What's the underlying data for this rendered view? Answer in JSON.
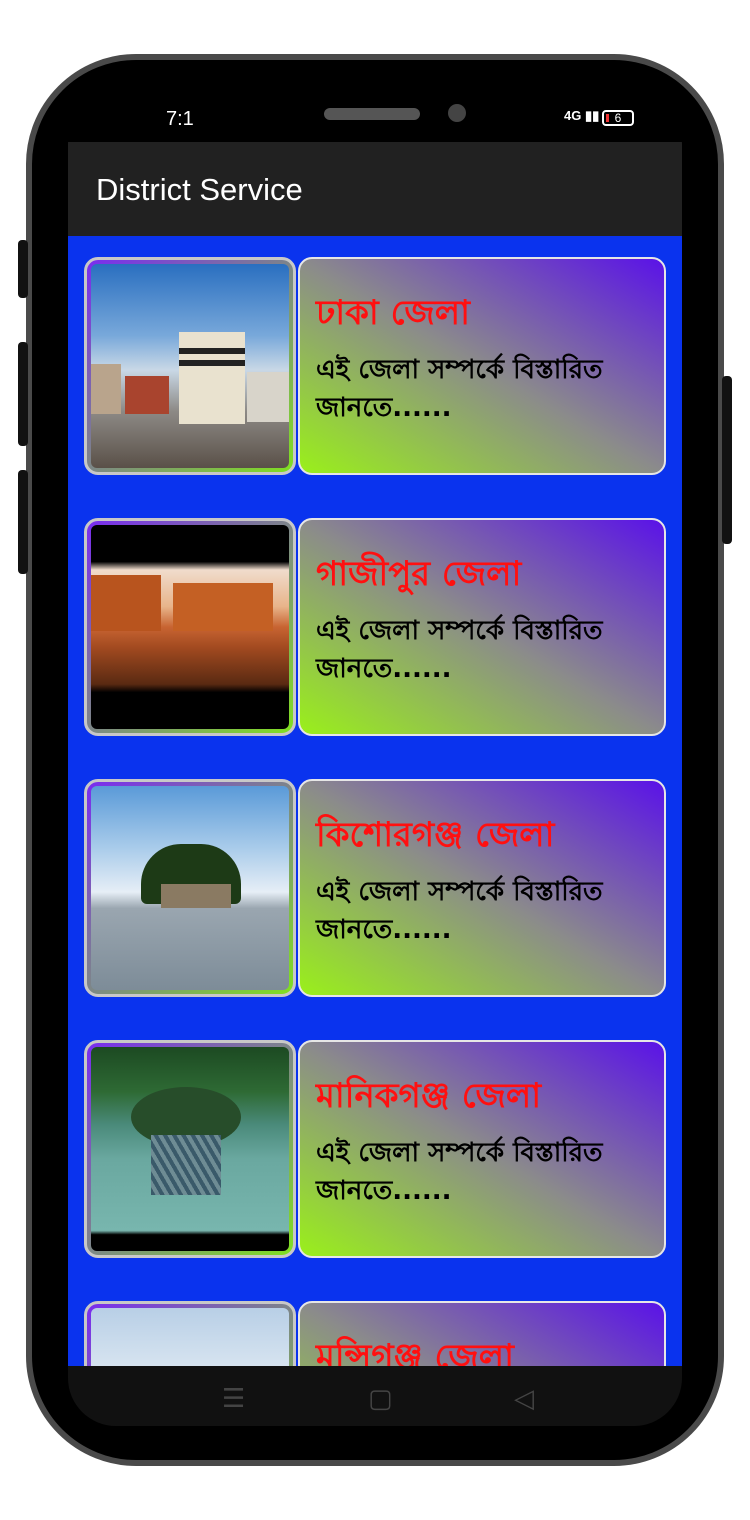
{
  "status_bar": {
    "time": "7:1",
    "network": "4G",
    "battery": "6"
  },
  "app_bar": {
    "title": "District Service"
  },
  "districts": [
    {
      "name": "ঢাকা জেলা",
      "description": "এই জেলা সম্পর্কে বিস্তারিত জানতে......",
      "image": "dhaka-mosque-photo"
    },
    {
      "name": "গাজীপুর জেলা",
      "description": "এই জেলা সম্পর্কে বিস্তারিত জানতে......",
      "image": "gazipur-building-photo"
    },
    {
      "name": "কিশোরগঞ্জ জেলা",
      "description": "এই জেলা সম্পর্কে বিস্তারিত জানতে......",
      "image": "kishoreganj-island-photo"
    },
    {
      "name": "মানিকগঞ্জ জেলা",
      "description": "এই জেলা সম্পর্কে বিস্তারিত জানতে......",
      "image": "manikganj-boats-photo"
    },
    {
      "name": "মুন্সিগঞ্জ জেলা",
      "description": "",
      "image": "munshiganj-sky-photo"
    }
  ],
  "nav_bar": {
    "menu_icon": "menu-icon",
    "home_icon": "home-icon",
    "back_icon": "back-icon"
  },
  "colors": {
    "app_bar": "#212121",
    "list_bg": "#0a33ee",
    "title_red": "#ff1010",
    "gradient_green": "#9af01a",
    "gradient_purple": "#5a12e8"
  }
}
